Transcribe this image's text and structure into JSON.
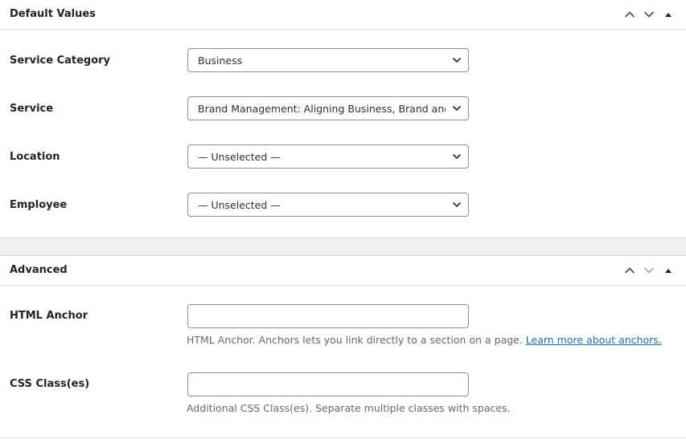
{
  "default_values": {
    "title": "Default Values",
    "fields": [
      {
        "label": "Service Category",
        "value": "Business"
      },
      {
        "label": "Service",
        "value": "Brand Management: Aligning Business, Brand and Behaviour"
      },
      {
        "label": "Location",
        "value": "— Unselected —"
      },
      {
        "label": "Employee",
        "value": "— Unselected —"
      }
    ]
  },
  "advanced": {
    "title": "Advanced",
    "html_anchor": {
      "label": "HTML Anchor",
      "value": "",
      "help": "HTML Anchor. Anchors lets you link directly to a section on a page. ",
      "help_link": "Learn more about anchors."
    },
    "css_classes": {
      "label": "CSS Class(es)",
      "value": "",
      "help": "Additional CSS Class(es). Separate multiple classes with spaces."
    }
  },
  "icons": {
    "move_up": "chevron-up-icon",
    "move_down": "chevron-down-icon",
    "toggle": "triangle-up-icon",
    "select_arrow": "chevron-down-icon"
  },
  "colors": {
    "link": "#2271b1",
    "text": "#1d2327",
    "help_text": "#646970",
    "border": "#8c8f94",
    "divider": "#dcdcde",
    "gap_background": "#f0f0f1"
  }
}
